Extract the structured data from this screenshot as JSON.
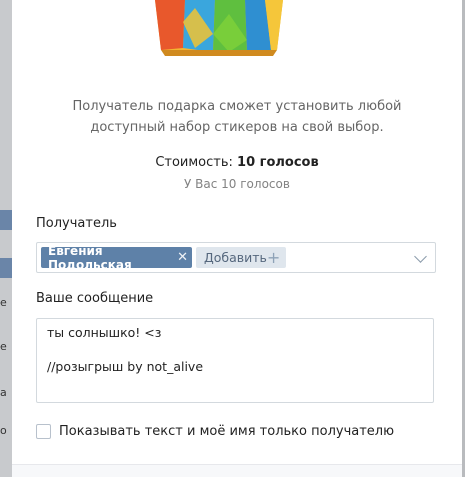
{
  "gift": {
    "description_line1": "Получатель подарка сможет установить любой",
    "description_line2": "доступный набор стикеров на свой выбор.",
    "price_label": "Стоимость:",
    "price_value": "10 голосов",
    "balance": "У Вас 10 голосов"
  },
  "recipient": {
    "label": "Получатель",
    "selected_name": "Евгения Подольская",
    "add_label": "Добавить"
  },
  "message": {
    "label": "Ваше сообщение",
    "line1": "ты солнышко! <з",
    "line2": "",
    "line3": "//розыгрыш by not_alive"
  },
  "privacy": {
    "checkbox_label": "Показывать текст и моё имя только получателю",
    "checked": false
  },
  "backdrop_chars": [
    "е",
    "е",
    "а",
    "о"
  ],
  "colors": {
    "chip_bg": "#5e81a8",
    "add_chip_bg": "#dfe6ed",
    "border": "#d3d9de"
  }
}
